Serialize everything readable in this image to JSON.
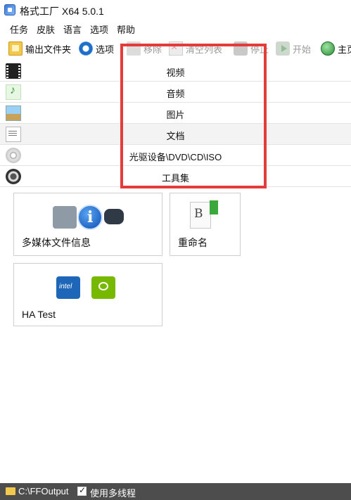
{
  "window": {
    "title": "格式工厂 X64 5.0.1"
  },
  "menu": [
    "任务",
    "皮肤",
    "语言",
    "选项",
    "帮助"
  ],
  "toolbar": {
    "output_folder": "输出文件夹",
    "options": "选项",
    "remove": "移除",
    "clear_list": "清空列表",
    "stop": "停止",
    "start": "开始",
    "home": "主页"
  },
  "categories": [
    "视频",
    "音频",
    "图片",
    "文档",
    "光驱设备\\DVD\\CD\\ISO",
    "工具集"
  ],
  "tiles": {
    "media_info": "多媒体文件信息",
    "rename": "重命名",
    "ha_test": "HA Test"
  },
  "status": {
    "output_path": "C:\\FFOutput",
    "multithread_label": "使用多线程",
    "multithread_checked": true
  },
  "highlight_color": "#e43b3b"
}
